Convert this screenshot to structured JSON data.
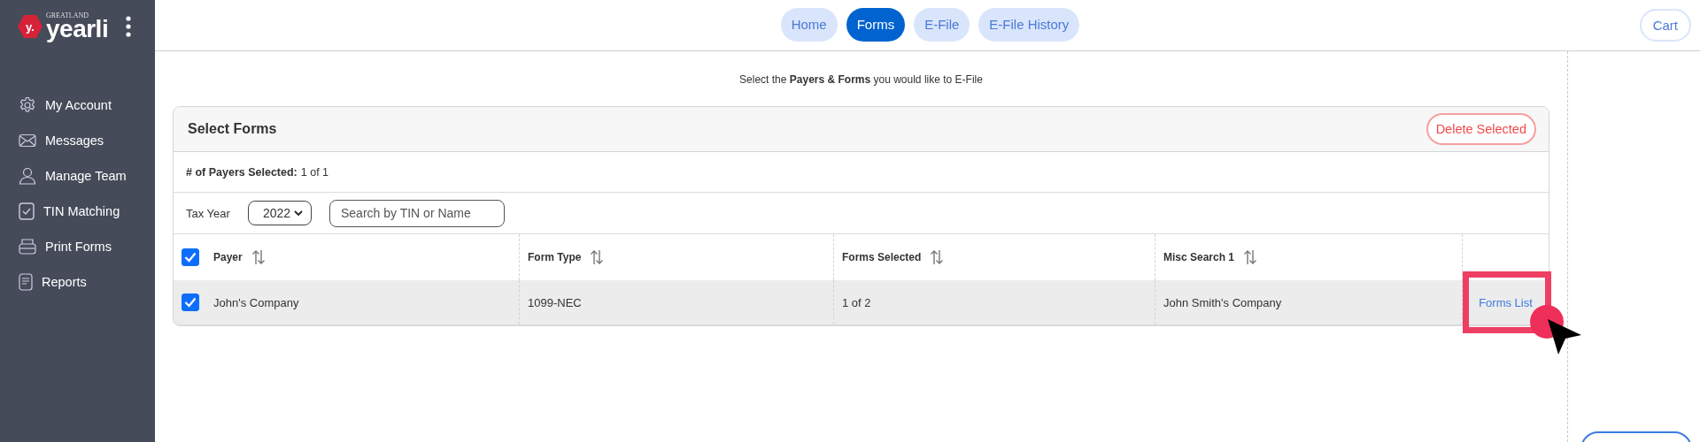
{
  "sidebar": {
    "logo": {
      "brand": "yearli",
      "tagline": "GREATLAND",
      "badge": "y."
    },
    "items": [
      {
        "label": "My Account"
      },
      {
        "label": "Messages"
      },
      {
        "label": "Manage Team"
      },
      {
        "label": "TIN Matching"
      },
      {
        "label": "Print Forms"
      },
      {
        "label": "Reports"
      }
    ]
  },
  "nav": {
    "tabs": [
      {
        "label": "Home",
        "selected": false
      },
      {
        "label": "Forms",
        "selected": true
      },
      {
        "label": "E-File",
        "selected": false
      },
      {
        "label": "E-File History",
        "selected": false
      }
    ],
    "cart": "Cart"
  },
  "instruction": "Select the **Payers & Forms** you would like to E-File",
  "card": {
    "title": "Select Forms",
    "delete_button": "Delete Selected",
    "payers_selected_label": "# of Payers Selected:",
    "payers_selected_value": "1 of 1",
    "tax_year_label": "Tax Year",
    "tax_year": "2022",
    "search": {
      "placeholder": "Search by TIN or Name"
    },
    "table": {
      "select_all_checked": true,
      "columns": [
        "Payer",
        "Form Type",
        "Forms Selected",
        "Misc Search 1"
      ],
      "rows": [
        {
          "checked": true,
          "cells": [
            "John's Company",
            "1099-NEC",
            "1 of 2",
            "John Smith's Company"
          ],
          "link": "Forms List"
        }
      ]
    }
  }
}
